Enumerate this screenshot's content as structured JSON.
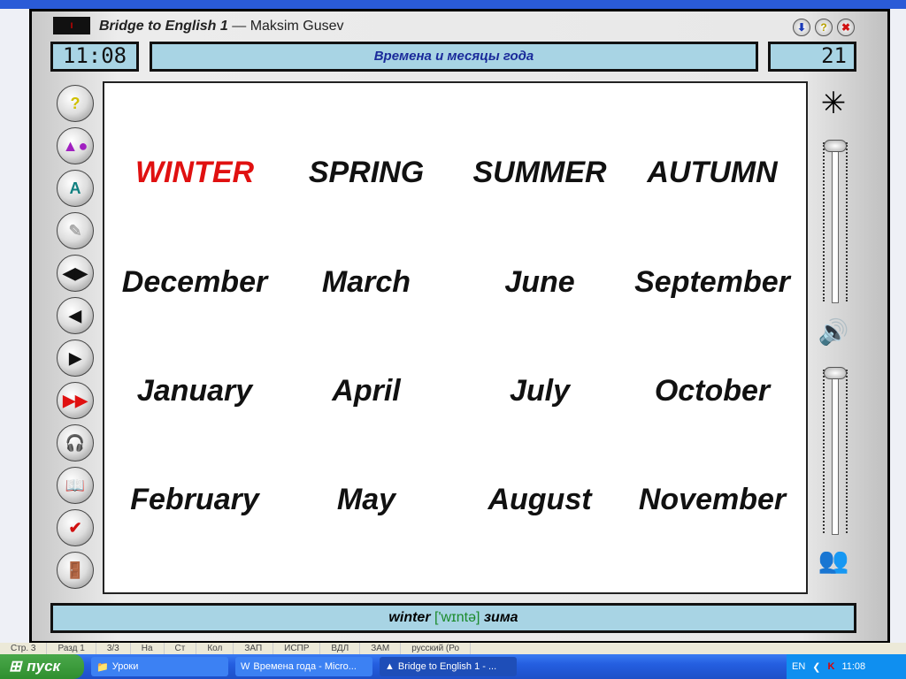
{
  "app": {
    "logo_text": "I",
    "title_bold": "Bridge to English 1",
    "title_rest": " — Maksim Gusev",
    "time": "11:08",
    "topic": "Времена и месяцы года",
    "counter": "21"
  },
  "title_buttons": [
    {
      "name": "minimize",
      "glyph": "⬇",
      "color": "#1a3ab8"
    },
    {
      "name": "help",
      "glyph": "?",
      "color": "#b8a000"
    },
    {
      "name": "close",
      "glyph": "✖",
      "color": "#d01010"
    }
  ],
  "side_buttons": [
    {
      "name": "help-button",
      "glyph": "?",
      "color": "#d0c000"
    },
    {
      "name": "shapes-button",
      "glyph": "▲●",
      "color": "#a020c0"
    },
    {
      "name": "alphabet-button",
      "glyph": "A",
      "color": "#108080"
    },
    {
      "name": "notes-button",
      "glyph": "✎",
      "color": "#aaa"
    },
    {
      "name": "prev-next-button",
      "glyph": "◀▶",
      "color": "#111"
    },
    {
      "name": "back-button",
      "glyph": "◀",
      "color": "#111"
    },
    {
      "name": "forward-button",
      "glyph": "▶",
      "color": "#111"
    },
    {
      "name": "fast-forward-button",
      "glyph": "▶▶",
      "color": "#e01010"
    },
    {
      "name": "headset-button",
      "glyph": "🎧",
      "color": "#208080"
    },
    {
      "name": "dictionary-button",
      "glyph": "📖",
      "color": "#a06000"
    },
    {
      "name": "check-button",
      "glyph": "✔",
      "color": "#d01010"
    },
    {
      "name": "exit-button",
      "glyph": "🚪",
      "color": "#a06000"
    }
  ],
  "grid": [
    [
      "WINTER",
      "SPRING",
      "SUMMER",
      "AUTUMN"
    ],
    [
      "December",
      "March",
      "June",
      "September"
    ],
    [
      "January",
      "April",
      "July",
      "October"
    ],
    [
      "February",
      "May",
      "August",
      "November"
    ]
  ],
  "highlight_color": "#e01010",
  "sliders": {
    "speed_level": 1.0,
    "volume_level": 1.0
  },
  "footer": {
    "word": "winter",
    "transcription": "['wɪntə]",
    "translation": "зима"
  },
  "statusbar": [
    "Стр. 3",
    "Разд 1",
    "3/3",
    "На",
    "Ст",
    "Кол",
    "ЗАП",
    "ИСПР",
    "ВДЛ",
    "ЗАМ",
    "русский (Ро"
  ],
  "taskbar": {
    "start": "пуск",
    "tasks": [
      "Уроки",
      "Времена года - Micro...",
      "Bridge to English 1 - ..."
    ],
    "lang": "EN",
    "clock": "11:08"
  }
}
